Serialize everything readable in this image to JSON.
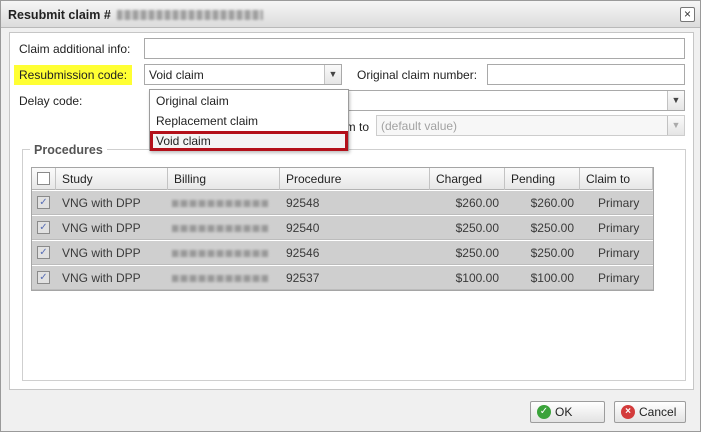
{
  "dialog": {
    "title": "Resubmit claim #",
    "close_glyph": "×"
  },
  "form": {
    "claim_additional_info_label": "Claim additional info:",
    "claim_additional_info_value": "",
    "resubmission_code_label": "Resubmission code:",
    "resubmission_code_value": "Void claim",
    "original_claim_number_label": "Original claim number:",
    "original_claim_number_value": "",
    "delay_code_label": "Delay code:",
    "delay_code_value": "",
    "claim_to_label": "im to",
    "claim_to_placeholder": "(default value)"
  },
  "dropdown": {
    "options": [
      "Original claim",
      "Replacement claim",
      "Void claim"
    ],
    "selected": "Void claim"
  },
  "procedures": {
    "legend": "Procedures",
    "columns": [
      "Study",
      "Billing",
      "Procedure",
      "Charged",
      "Pending",
      "Claim to"
    ],
    "rows": [
      {
        "checked": true,
        "study": "VNG with DPP",
        "procedure": "92548",
        "charged": "$260.00",
        "pending": "$260.00",
        "claim_to": "Primary"
      },
      {
        "checked": true,
        "study": "VNG with DPP",
        "procedure": "92540",
        "charged": "$250.00",
        "pending": "$250.00",
        "claim_to": "Primary"
      },
      {
        "checked": true,
        "study": "VNG with DPP",
        "procedure": "92546",
        "charged": "$250.00",
        "pending": "$250.00",
        "claim_to": "Primary"
      },
      {
        "checked": true,
        "study": "VNG with DPP",
        "procedure": "92537",
        "charged": "$100.00",
        "pending": "$100.00",
        "claim_to": "Primary"
      }
    ],
    "check_glyph": "✓"
  },
  "buttons": {
    "ok_label": "OK",
    "cancel_label": "Cancel"
  },
  "colors": {
    "highlight": "#ffff33",
    "selected_outline": "#b3101a"
  },
  "icons": {
    "ok": "check-circle-icon",
    "cancel": "x-circle-icon",
    "dropdown": "chevron-down-icon"
  }
}
